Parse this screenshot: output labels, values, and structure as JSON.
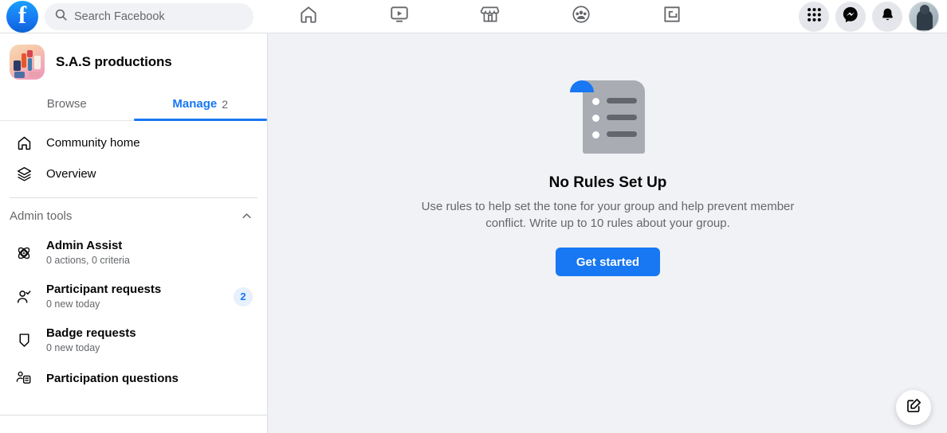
{
  "search": {
    "placeholder": "Search Facebook"
  },
  "topnav": {
    "items": [
      {
        "name": "home-icon",
        "label": "Home"
      },
      {
        "name": "video-icon",
        "label": "Video"
      },
      {
        "name": "marketplace-icon",
        "label": "Marketplace"
      },
      {
        "name": "groups-icon",
        "label": "Groups"
      },
      {
        "name": "gaming-icon",
        "label": "Gaming"
      }
    ],
    "right": [
      {
        "name": "menu-grid-icon",
        "label": "Menu"
      },
      {
        "name": "messenger-icon",
        "label": "Messenger"
      },
      {
        "name": "notifications-bell-icon",
        "label": "Notifications"
      },
      {
        "name": "profile-avatar",
        "label": "Account"
      }
    ]
  },
  "sidebar": {
    "group_name": "S.A.S productions",
    "tabs": [
      {
        "label": "Browse",
        "count": "",
        "active": false
      },
      {
        "label": "Manage",
        "count": "2",
        "active": true
      }
    ],
    "nav": [
      {
        "label": "Community home",
        "icon": "home-icon"
      },
      {
        "label": "Overview",
        "icon": "layers-icon"
      }
    ],
    "section": {
      "title": "Admin tools",
      "chevron": "chevron-up-icon"
    },
    "admin_tools": [
      {
        "label": "Admin Assist",
        "sub": "0 actions, 0 criteria",
        "badge": "",
        "icon": "admin-assist-icon"
      },
      {
        "label": "Participant requests",
        "sub": "0 new today",
        "badge": "2",
        "icon": "person-check-icon"
      },
      {
        "label": "Badge requests",
        "sub": "0 new today",
        "badge": "",
        "icon": "badge-shield-icon"
      },
      {
        "label": "Participation questions",
        "sub": "",
        "badge": "",
        "icon": "person-form-icon"
      }
    ]
  },
  "main": {
    "empty_state": {
      "title": "No Rules Set Up",
      "description": "Use rules to help set the tone for your group and help prevent member conflict. Write up to 10 rules about your group.",
      "cta_label": "Get started",
      "illustration": "rules-document-icon"
    },
    "fab": {
      "icon": "compose-edit-icon"
    }
  },
  "colors": {
    "accent": "#1877f2",
    "page_bg": "#f0f2f5",
    "surface": "#ffffff",
    "text_primary": "#050505",
    "text_secondary": "#65676b",
    "badge_bg": "#e7f0fd"
  }
}
